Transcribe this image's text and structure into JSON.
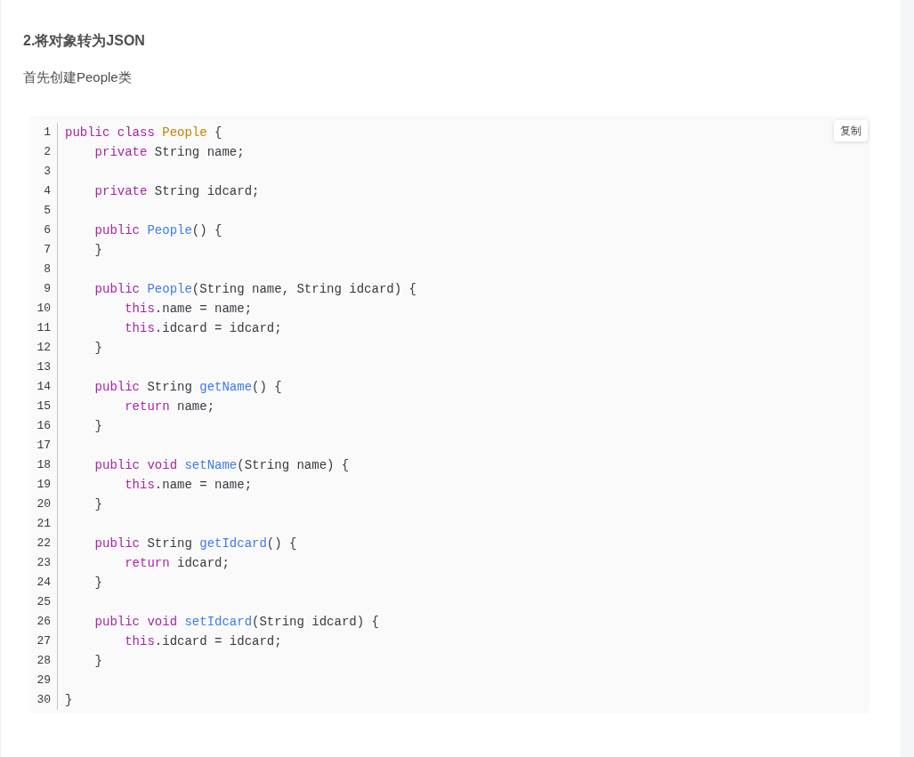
{
  "heading": "2.将对象转为JSON",
  "paragraph": "首先创建People类",
  "code_block": {
    "copy_button": "复制",
    "lines": [
      {
        "number": "1",
        "tokens": [
          {
            "kind": "keyword",
            "text": "public "
          },
          {
            "kind": "keyword",
            "text": "class "
          },
          {
            "kind": "class",
            "text": "People"
          },
          {
            "kind": "plain",
            "text": " {"
          }
        ]
      },
      {
        "number": "2",
        "tokens": [
          {
            "kind": "keyword",
            "text": "    private"
          },
          {
            "kind": "plain",
            "text": " String name;"
          }
        ]
      },
      {
        "number": "3"
      },
      {
        "number": "4",
        "tokens": [
          {
            "kind": "keyword",
            "text": "    private"
          },
          {
            "kind": "plain",
            "text": " String idcard;"
          }
        ]
      },
      {
        "number": "5"
      },
      {
        "number": "6",
        "tokens": [
          {
            "kind": "keyword",
            "text": "    public "
          },
          {
            "kind": "function",
            "text": "People"
          },
          {
            "kind": "plain",
            "text": "() {"
          }
        ]
      },
      {
        "number": "7",
        "tokens": [
          {
            "kind": "plain",
            "text": "    }"
          }
        ]
      },
      {
        "number": "8"
      },
      {
        "number": "9",
        "tokens": [
          {
            "kind": "keyword",
            "text": "    public "
          },
          {
            "kind": "function",
            "text": "People"
          },
          {
            "kind": "plain",
            "text": "(String name, String idcard) {"
          }
        ]
      },
      {
        "number": "10",
        "tokens": [
          {
            "kind": "keyword",
            "text": "        this"
          },
          {
            "kind": "plain",
            "text": ".name = name;"
          }
        ]
      },
      {
        "number": "11",
        "tokens": [
          {
            "kind": "keyword",
            "text": "        this"
          },
          {
            "kind": "plain",
            "text": ".idcard = idcard;"
          }
        ]
      },
      {
        "number": "12",
        "tokens": [
          {
            "kind": "plain",
            "text": "    }"
          }
        ]
      },
      {
        "number": "13"
      },
      {
        "number": "14",
        "tokens": [
          {
            "kind": "keyword",
            "text": "    public"
          },
          {
            "kind": "plain",
            "text": " String "
          },
          {
            "kind": "function",
            "text": "getName"
          },
          {
            "kind": "plain",
            "text": "() {"
          }
        ]
      },
      {
        "number": "15",
        "tokens": [
          {
            "kind": "keyword",
            "text": "        return"
          },
          {
            "kind": "plain",
            "text": " name;"
          }
        ]
      },
      {
        "number": "16",
        "tokens": [
          {
            "kind": "plain",
            "text": "    }"
          }
        ]
      },
      {
        "number": "17"
      },
      {
        "number": "18",
        "tokens": [
          {
            "kind": "keyword",
            "text": "    public "
          },
          {
            "kind": "keyword",
            "text": "void "
          },
          {
            "kind": "function",
            "text": "setName"
          },
          {
            "kind": "plain",
            "text": "(String name) {"
          }
        ]
      },
      {
        "number": "19",
        "tokens": [
          {
            "kind": "keyword",
            "text": "        this"
          },
          {
            "kind": "plain",
            "text": ".name = name;"
          }
        ]
      },
      {
        "number": "20",
        "tokens": [
          {
            "kind": "plain",
            "text": "    }"
          }
        ]
      },
      {
        "number": "21"
      },
      {
        "number": "22",
        "tokens": [
          {
            "kind": "keyword",
            "text": "    public"
          },
          {
            "kind": "plain",
            "text": " String "
          },
          {
            "kind": "function",
            "text": "getIdcard"
          },
          {
            "kind": "plain",
            "text": "() {"
          }
        ]
      },
      {
        "number": "23",
        "tokens": [
          {
            "kind": "keyword",
            "text": "        return"
          },
          {
            "kind": "plain",
            "text": " idcard;"
          }
        ]
      },
      {
        "number": "24",
        "tokens": [
          {
            "kind": "plain",
            "text": "    }"
          }
        ]
      },
      {
        "number": "25"
      },
      {
        "number": "26",
        "tokens": [
          {
            "kind": "keyword",
            "text": "    public "
          },
          {
            "kind": "keyword",
            "text": "void "
          },
          {
            "kind": "function",
            "text": "setIdcard"
          },
          {
            "kind": "plain",
            "text": "(String idcard) {"
          }
        ]
      },
      {
        "number": "27",
        "tokens": [
          {
            "kind": "keyword",
            "text": "        this"
          },
          {
            "kind": "plain",
            "text": ".idcard = idcard;"
          }
        ]
      },
      {
        "number": "28",
        "tokens": [
          {
            "kind": "plain",
            "text": "    }"
          }
        ]
      },
      {
        "number": "29"
      },
      {
        "number": "30",
        "tokens": [
          {
            "kind": "plain",
            "text": "}"
          }
        ]
      }
    ]
  }
}
